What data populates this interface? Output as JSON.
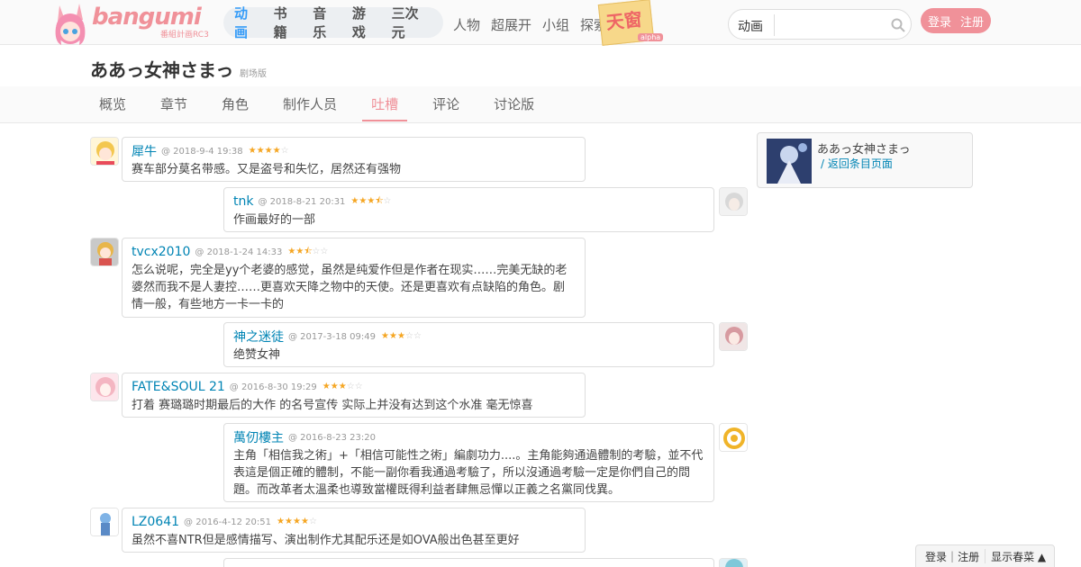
{
  "brand": {
    "logo_text": "bangumi",
    "logo_sub": "番組計画RC3"
  },
  "main_nav": [
    {
      "label": "动画",
      "active": true
    },
    {
      "label": "书籍",
      "active": false
    },
    {
      "label": "音乐",
      "active": false
    },
    {
      "label": "游戏",
      "active": false
    },
    {
      "label": "三次元",
      "active": false
    }
  ],
  "sec_nav": [
    "人物",
    "超展开",
    "小组",
    "探索"
  ],
  "ad": {
    "text": "天窗",
    "tag": "alpha"
  },
  "search": {
    "category": "动画",
    "value": "",
    "placeholder": ""
  },
  "auth": {
    "login": "登录",
    "register": "注册"
  },
  "subject": {
    "title": "ああっ女神さまっ",
    "type_tag": "剧场版"
  },
  "subnav": [
    {
      "label": "概览",
      "active": false
    },
    {
      "label": "章节",
      "active": false
    },
    {
      "label": "角色",
      "active": false
    },
    {
      "label": "制作人员",
      "active": false
    },
    {
      "label": "吐槽",
      "active": true
    },
    {
      "label": "评论",
      "active": false
    },
    {
      "label": "讨论版",
      "active": false
    }
  ],
  "comments": [
    {
      "user": "犀牛",
      "time": "@ 2018-9-4 19:38",
      "rating": 8,
      "text": "赛车部分莫名带感。又是盗号和失忆，居然还有强物",
      "side": "left",
      "avatar_color": "#f3c74f"
    },
    {
      "user": "tnk",
      "time": "@ 2018-8-21 20:31",
      "rating": 7,
      "text": "作画最好的一部",
      "side": "right",
      "avatar_color": "#c9c9c9"
    },
    {
      "user": "tvcx2010",
      "time": "@ 2018-1-24 14:33",
      "rating": 5,
      "text": "怎么说呢，完全是yy个老婆的感觉，虽然是纯爱作但是作者在现实……完美无缺的老婆然而我不是人妻控……更喜欢天降之物中的天使。还是更喜欢有点缺陷的角色。剧情一般，有些地方一卡一卡的",
      "side": "left",
      "avatar_color": "#e8b64a"
    },
    {
      "user": "神之迷徒",
      "time": "@ 2017-3-18 09:49",
      "rating": 6,
      "text": "绝赞女神",
      "side": "right",
      "avatar_color": "#d79aa0"
    },
    {
      "user": "FATE&SOUL 21",
      "time": "@ 2016-8-30 19:29",
      "rating": 6,
      "text": "打着 赛璐璐时期最后的大作 的名号宣传 实际上并没有达到这个水准 毫无惊喜",
      "side": "left",
      "avatar_color": "#f4b6c2"
    },
    {
      "user": "萬仞樓主",
      "time": "@ 2016-8-23 23:20",
      "rating": 0,
      "text": "主角「相信我之術」+「相信可能性之術」編劇功力....。主角能夠通過體制的考驗，並不代表這是個正確的體制，不能一副你看我通過考驗了，所以沒通過考驗一定是你們自己的問題。而改革者太溫柔也導致當權既得利益者肆無忌憚以正義之名黨同伐異。",
      "side": "right",
      "avatar_color": "#f0b429"
    },
    {
      "user": "LZ0641",
      "time": "@ 2016-4-12 20:51",
      "rating": 8,
      "text": "虽然不喜NTR但是感情描写、演出制作尤其配乐还是如OVA般出色甚至更好",
      "side": "left",
      "avatar_color": "#7fb3e6"
    }
  ],
  "sidebar": {
    "title": "ああっ女神さまっ",
    "back_link": "/ 返回条目页面"
  },
  "bottom_bar": {
    "login": "登录",
    "register": "注册",
    "toggle": "显示春菜 ▲"
  },
  "colors": {
    "brand_pink": "#f09199",
    "link_blue": "#0084b4",
    "active_blue": "#369cf8",
    "star": "#f5a623"
  }
}
